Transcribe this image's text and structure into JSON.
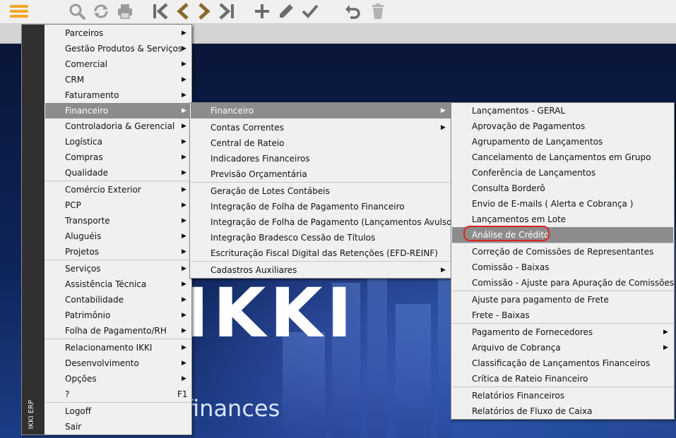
{
  "toolbar": {
    "icons": [
      "hamburger-icon",
      "search-icon",
      "refresh-icon",
      "print-icon",
      "first-record-icon",
      "previous-record-icon",
      "next-record-icon",
      "last-record-icon",
      "add-icon",
      "edit-icon",
      "confirm-icon",
      "undo-icon",
      "delete-icon"
    ],
    "accent_color": "#f5a623"
  },
  "brand": {
    "big": "IKKI",
    "sub": "finances"
  },
  "main_menu": {
    "side_label": "IKKI ERP",
    "items": [
      {
        "label": "Parceiros",
        "submenu": true
      },
      {
        "label": "Gestão Produtos & Serviços",
        "submenu": true
      },
      {
        "label": "Comercial",
        "submenu": true
      },
      {
        "label": "CRM",
        "submenu": true
      },
      {
        "label": "Faturamento",
        "submenu": true
      },
      {
        "label": "Financeiro",
        "submenu": true,
        "selected": true
      },
      {
        "label": "Controladoria & Gerencial",
        "submenu": true
      },
      {
        "label": "Logística",
        "submenu": true
      },
      {
        "label": "Compras",
        "submenu": true
      },
      {
        "label": "Qualidade",
        "submenu": true
      },
      {
        "label": "Comércio Exterior",
        "submenu": true
      },
      {
        "label": "PCP",
        "submenu": true
      },
      {
        "label": "Transporte",
        "submenu": true
      },
      {
        "label": "Aluguéis",
        "submenu": true
      },
      {
        "label": "Projetos",
        "submenu": true
      },
      {
        "label": "Serviços",
        "submenu": true
      },
      {
        "label": "Assistência Técnica",
        "submenu": true
      },
      {
        "label": "Contabilidade",
        "submenu": true
      },
      {
        "label": "Patrimônio",
        "submenu": true
      },
      {
        "label": "Folha de Pagamento/RH",
        "submenu": true
      },
      {
        "label": "Relacionamento IKKI",
        "submenu": true
      },
      {
        "label": "Desenvolvimento",
        "submenu": true
      },
      {
        "label": "Opções",
        "submenu": true
      },
      {
        "label": "?",
        "shortcut": "F1"
      },
      {
        "label": "Logoff"
      },
      {
        "label": "Sair"
      }
    ]
  },
  "sub_menu": {
    "items": [
      {
        "label": "Financeiro",
        "submenu": true,
        "selected": true
      },
      {
        "label": "Contas Correntes",
        "submenu": true
      },
      {
        "label": "Central de Rateio"
      },
      {
        "label": "Indicadores Financeiros"
      },
      {
        "label": "Previsão Orçamentária"
      },
      {
        "label": "Geração de Lotes Contábeis"
      },
      {
        "label": "Integração de Folha de Pagamento Financeiro"
      },
      {
        "label": "Integração de Folha de Pagamento (Lançamentos Avulsos)"
      },
      {
        "label": "Integração Bradesco Cessão de Títulos"
      },
      {
        "label": "Escrituração Fiscal Digital das Retenções (EFD-REINF)"
      },
      {
        "label": "Cadastros Auxiliares",
        "submenu": true
      }
    ]
  },
  "fin_menu": {
    "items": [
      {
        "label": "Lançamentos - GERAL"
      },
      {
        "label": "Aprovação de Pagamentos"
      },
      {
        "label": "Agrupamento de Lançamentos"
      },
      {
        "label": "Cancelamento de Lançamentos em Grupo"
      },
      {
        "label": "Conferência de Lançamentos"
      },
      {
        "label": "Consulta Borderô"
      },
      {
        "label": "Envio de E-mails ( Alerta e Cobrança )"
      },
      {
        "label": "Lançamentos em Lote"
      },
      {
        "label": "Análise de Crédito",
        "hover": true
      },
      {
        "label": "Correção de Comissões de Representantes"
      },
      {
        "label": "Comissão - Baixas"
      },
      {
        "label": "Comissão - Ajuste para Apuração de Comissões"
      },
      {
        "label": "Ajuste para pagamento de Frete"
      },
      {
        "label": "Frete - Baixas"
      },
      {
        "label": "Pagamento de Fornecedores",
        "submenu": true
      },
      {
        "label": "Arquivo de Cobrança",
        "submenu": true
      },
      {
        "label": "Classificação de Lançamentos Financeiros"
      },
      {
        "label": "Crítica de Rateio Financeiro"
      },
      {
        "label": "Relatórios Financeiros"
      },
      {
        "label": "Relatórios de Fluxo de Caixa"
      }
    ]
  }
}
